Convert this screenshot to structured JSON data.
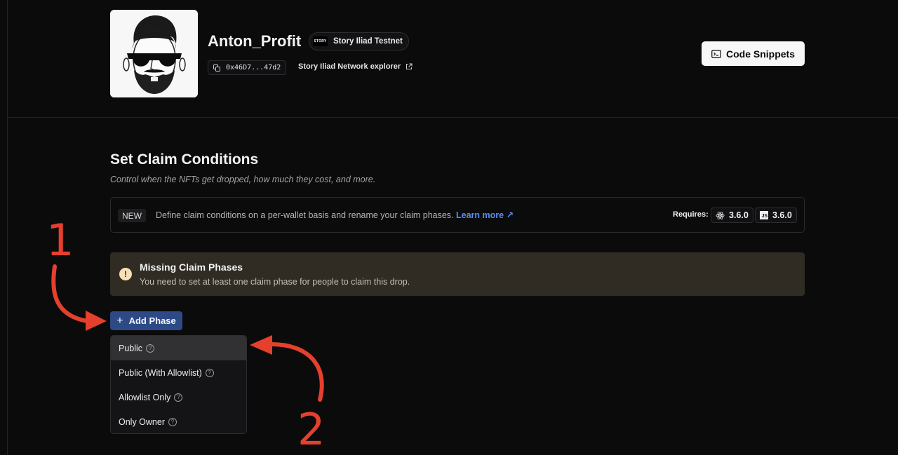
{
  "header": {
    "contract_name": "Anton_Profit",
    "chain": {
      "logo_text": "STORY",
      "name": "Story Iliad Testnet"
    },
    "address": "0x46D7...47d2",
    "explorer_label": "Story Iliad Network explorer",
    "code_snippets_label": "Code Snippets"
  },
  "claim_conditions": {
    "title": "Set Claim Conditions",
    "subtitle": "Control when the NFTs get dropped, how much they cost, and more.",
    "info": {
      "badge": "NEW",
      "text": "Define claim conditions on a per-wallet basis and rename your claim phases.",
      "learn_more": "Learn more ↗",
      "requires_label": "Requires:",
      "react_version": "3.6.0",
      "js_icon_text": "JS",
      "js_version": "3.6.0"
    },
    "alert": {
      "icon": "!",
      "title": "Missing Claim Phases",
      "description": "You need to set at least one claim phase for people to claim this drop."
    },
    "add_phase_label": "Add Phase",
    "phase_menu": [
      {
        "label": "Public",
        "active": true
      },
      {
        "label": "Public (With Allowlist)",
        "active": false
      },
      {
        "label": "Allowlist Only",
        "active": false
      },
      {
        "label": "Only Owner",
        "active": false
      }
    ]
  },
  "annotations": {
    "step1": "1",
    "step2": "2"
  },
  "colors": {
    "accent_blue": "#2d4a86",
    "link_blue": "#5b8dee",
    "annotation_red": "#e5402d",
    "alert_bg": "#302c24"
  }
}
